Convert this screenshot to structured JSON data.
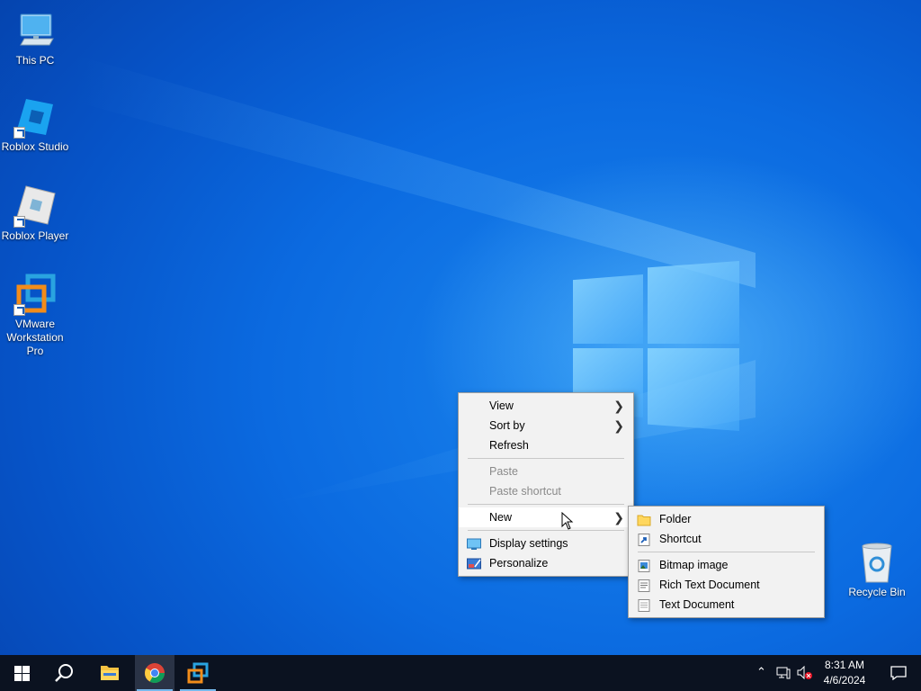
{
  "desktop": {
    "icons": [
      {
        "label": "This PC",
        "icon": "computer-icon"
      },
      {
        "label": "Roblox Studio",
        "icon": "roblox-studio-icon"
      },
      {
        "label": "Roblox Player",
        "icon": "roblox-player-icon"
      },
      {
        "label": "VMware Workstation Pro",
        "icon": "vmware-icon"
      },
      {
        "label": "Recycle Bin",
        "icon": "recycle-bin-icon"
      }
    ]
  },
  "context_menu": {
    "items": [
      {
        "label": "View",
        "submenu": true
      },
      {
        "label": "Sort by",
        "submenu": true
      },
      {
        "label": "Refresh"
      },
      {
        "label": "Paste",
        "disabled": true
      },
      {
        "label": "Paste shortcut",
        "disabled": true
      },
      {
        "label": "New",
        "submenu": true,
        "highlighted": true
      },
      {
        "label": "Display settings",
        "icon": "display-icon"
      },
      {
        "label": "Personalize",
        "icon": "personalize-icon"
      }
    ]
  },
  "new_submenu": {
    "items": [
      {
        "label": "Folder",
        "icon": "folder-icon"
      },
      {
        "label": "Shortcut",
        "icon": "shortcut-icon"
      },
      {
        "label": "Bitmap image",
        "icon": "bitmap-icon"
      },
      {
        "label": "Rich Text Document",
        "icon": "rtf-icon"
      },
      {
        "label": "Text Document",
        "icon": "text-doc-icon"
      }
    ]
  },
  "taskbar": {
    "apps": [
      "start-icon",
      "search-icon",
      "file-explorer-icon",
      "chrome-icon",
      "vmware-icon"
    ],
    "active_app": "chrome-icon",
    "clock": {
      "time": "8:31 AM",
      "date": "4/6/2024"
    },
    "colors": {
      "background": "#0b1220",
      "accent": "#0a63d8"
    }
  }
}
